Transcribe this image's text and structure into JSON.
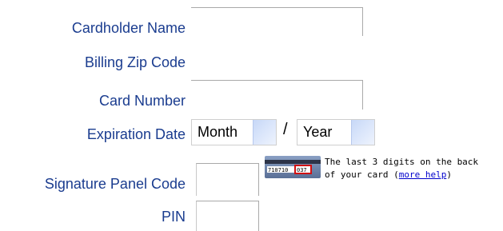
{
  "form": {
    "cardholder_name_label": "Cardholder Name",
    "billing_zip_label": "Billing Zip Code",
    "card_number_label": "Card Number",
    "expiration_label": "Expiration Date",
    "month_selected": "Month",
    "separator": "/",
    "year_selected": "Year",
    "signature_label": "Signature Panel Code",
    "pin_label": "PIN",
    "signature_hint_line1": "The last 3 digits on the back",
    "signature_hint_line2_prefix": "of your card (",
    "more_help_link": "more help",
    "signature_hint_line2_suffix": ")",
    "card_digits": "710710",
    "card_cvv": "037"
  },
  "colors": {
    "label": "#1a3c8f",
    "link": "#0000cc",
    "cvv_box": "#d01010"
  },
  "icons": [
    "chevron-down-icon",
    "card-back-icon"
  ]
}
